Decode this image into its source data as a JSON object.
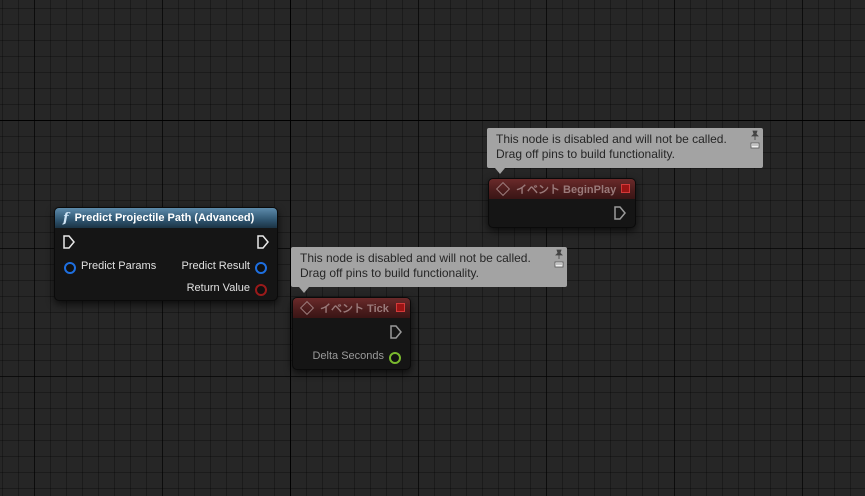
{
  "nodes": {
    "predict": {
      "title": "Predict Projectile Path (Advanced)",
      "glyph": "f",
      "inputs": [
        "Predict Params"
      ],
      "outputs": [
        "Predict Result",
        "Return Value"
      ]
    },
    "begin_play": {
      "title": "イベント BeginPlay",
      "comment_line1": "This node is disabled and will not be called.",
      "comment_line2": "Drag off pins to build functionality."
    },
    "tick": {
      "title": "イベント Tick",
      "output": "Delta Seconds",
      "comment_line1": "This node is disabled and will not be called.",
      "comment_line2": "Drag off pins to build functionality."
    }
  },
  "colors": {
    "function_header": "#2f5570",
    "event_header": "#4a1c1c",
    "struct_pin": "#1e6fe0",
    "bool_pin": "#9a1a1a",
    "float_pin": "#7ab92e",
    "comment_bg": "#a3a3a3"
  },
  "icons": [
    "function-icon",
    "event-icon",
    "exec-pin-icon",
    "pin-icon",
    "comment-bubble-icon",
    "delegate-icon"
  ]
}
